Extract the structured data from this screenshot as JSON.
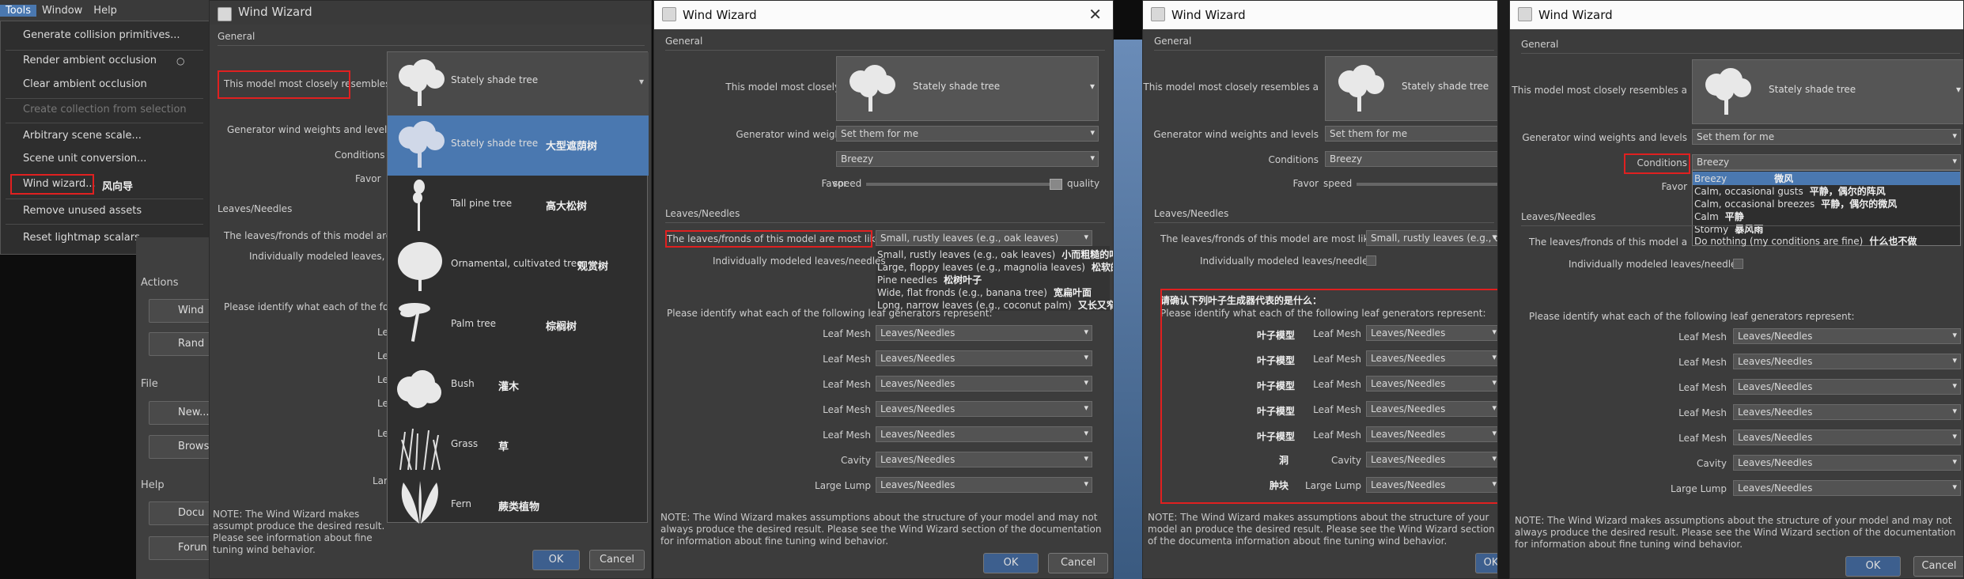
{
  "menu": {
    "bar": [
      "Tools",
      "Window",
      "Help"
    ],
    "items": [
      "Generate collision primitives...",
      "Render ambient occlusion",
      "Clear ambient occlusion",
      "Create collection from selection",
      "Arbitrary scene scale...",
      "Scene unit conversion...",
      "Wind wizard...",
      "Remove unused assets",
      "Reset lightmap scalars"
    ],
    "wind_cn": "风向导"
  },
  "panel": {
    "actions": "Actions",
    "wind": "Wind",
    "random": "Rand",
    "file": "File",
    "new": "New...",
    "browse": "Brows",
    "help": "Help",
    "docs": "Docu",
    "forum": "Forun"
  },
  "wizard": {
    "title": "Wind Wizard",
    "general": "General",
    "resembles": "This model most closely resembles a",
    "tree": "Stately shade tree",
    "gen_weights": "Generator wind weights and levels",
    "gen_value": "Set them for me",
    "conditions": "Conditions",
    "cond_value": "Breezy",
    "favor": "Favor",
    "speed": "speed",
    "quality": "quality",
    "leaves_sec": "Leaves/Needles",
    "leaves_like": "The leaves/fronds of this model are most like",
    "leaves_value": "Small, rustly leaves (e.g., oak leaves)",
    "individual": "Individually modeled leaves/needles",
    "identify": "Please identify what each of the following leaf generators represent:",
    "gen_rows": [
      "Leaf Mesh",
      "Leaf Mesh",
      "Leaf Mesh",
      "Leaf Mesh",
      "Leaf Mesh",
      "Cavity",
      "Large Lump"
    ],
    "gen_value_row": "Leaves/Needles",
    "note": "NOTE:  The Wind Wizard makes assumptions about the structure of your model and may not always produce the desired result.  Please see the Wind Wizard section of the documentation for information about fine tuning wind behavior.",
    "ok": "OK",
    "cancel": "Cancel"
  },
  "w1": {
    "resembles_cut": "This model most closely resembles a",
    "conditions": "Conditions",
    "favor": "Favor",
    "leaves_like_cut": "The leaves/fronds of this model are",
    "individual_cut": "Individually modeled leaves,",
    "identify_cut": "Please identify what each of the follo",
    "note_cut": "NOTE:  The Wind Wizard makes assumpt produce the desired result.  Please see information about fine tuning wind behavior.",
    "trees": [
      {
        "label": "Stately shade tree",
        "cn": "大型遮荫树"
      },
      {
        "label": "Tall pine tree",
        "cn": "高大松树"
      },
      {
        "label": "Ornamental, cultivated tree",
        "cn": "观赏树"
      },
      {
        "label": "Palm tree",
        "cn": "棕榈树"
      },
      {
        "label": "Bush",
        "cn": "灌木"
      },
      {
        "label": "Grass",
        "cn": "草"
      },
      {
        "label": "Fern",
        "cn": "蕨类植物"
      }
    ],
    "cut_rows": [
      "Le",
      "Le",
      "Le",
      "Le",
      "Le",
      "Lar"
    ]
  },
  "w2": {
    "options": [
      {
        "label": "Small, rustly leaves (e.g., oak leaves)",
        "cn": "小而粗糙的叶子"
      },
      {
        "label": "Large, floppy leaves (e.g., magnolia leaves)",
        "cn": "松软的大叶子"
      },
      {
        "label": "Pine needles",
        "cn": "松树叶子"
      },
      {
        "label": "Wide, flat fronds (e.g., banana tree)",
        "cn": "宽扁叶面"
      },
      {
        "label": "Long, narrow leaves (e.g., coconut palm)",
        "cn": "又长又窄的叶子"
      }
    ]
  },
  "w3": {
    "cn_title": "请确认下列叶子生成器代表的是什么：",
    "row_cn": [
      "叶子模型",
      "叶子模型",
      "叶子模型",
      "叶子模型",
      "叶子模型",
      "洞",
      "肿块"
    ],
    "note_cut": "NOTE:  The Wind Wizard makes assumptions about the structure of your model an produce the desired result.  Please see the Wind Wizard section of the documenta information about fine tuning wind behavior."
  },
  "w4": {
    "conds": [
      {
        "label": "Breezy",
        "cn": "微风"
      },
      {
        "label": "Calm, occasional gusts",
        "cn": "平静，偶尔的阵风"
      },
      {
        "label": "Calm, occasional breezes",
        "cn": "平静，偶尔的微风"
      },
      {
        "label": "Calm",
        "cn": "平静"
      },
      {
        "label": "Stormy",
        "cn": "暴风雨"
      },
      {
        "label": "Do nothing (my conditions are fine)",
        "cn": "什么也不做"
      }
    ],
    "leaves_like_cut": "The leaves/fronds of this model a"
  }
}
